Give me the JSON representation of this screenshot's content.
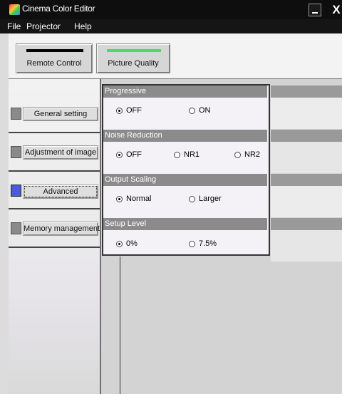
{
  "window": {
    "title": "Cinema Color Editor",
    "close_glyph": "X"
  },
  "menu": [
    "File",
    "Projector",
    "Help"
  ],
  "toolbar": {
    "buttons": [
      {
        "label": "Remote Control",
        "stripe_color": "#000000"
      },
      {
        "label": "Picture Quality",
        "stripe_color": "#4cd964"
      }
    ]
  },
  "nav": {
    "items": [
      {
        "label": "General setting",
        "indicator_color": "#8a8a8a"
      },
      {
        "label": "Adjustment of image",
        "indicator_color": "#8a8a8a"
      },
      {
        "label": "Advanced",
        "indicator_color": "#4a5ad8",
        "selected": true
      },
      {
        "label": "Memory management",
        "indicator_color": "#8a8a8a"
      }
    ]
  },
  "settings": {
    "progressive": {
      "label": "Progressive",
      "options": [
        "OFF",
        "ON"
      ],
      "selected": "OFF"
    },
    "noise_reduction": {
      "label": "Noise Reduction",
      "options": [
        "OFF",
        "NR1",
        "NR2"
      ],
      "selected": "OFF"
    },
    "output_scaling": {
      "label": "Output Scaling",
      "options": [
        "Normal",
        "Larger"
      ],
      "selected": "Normal"
    },
    "setup_level": {
      "label": "Setup Level",
      "options": [
        "0%",
        "7.5%"
      ],
      "selected": "0%"
    }
  },
  "colors": {
    "titlebar": "#0e0e0e",
    "section_header": "#8b8b8b",
    "selected_indicator": "#4a5ad8"
  }
}
